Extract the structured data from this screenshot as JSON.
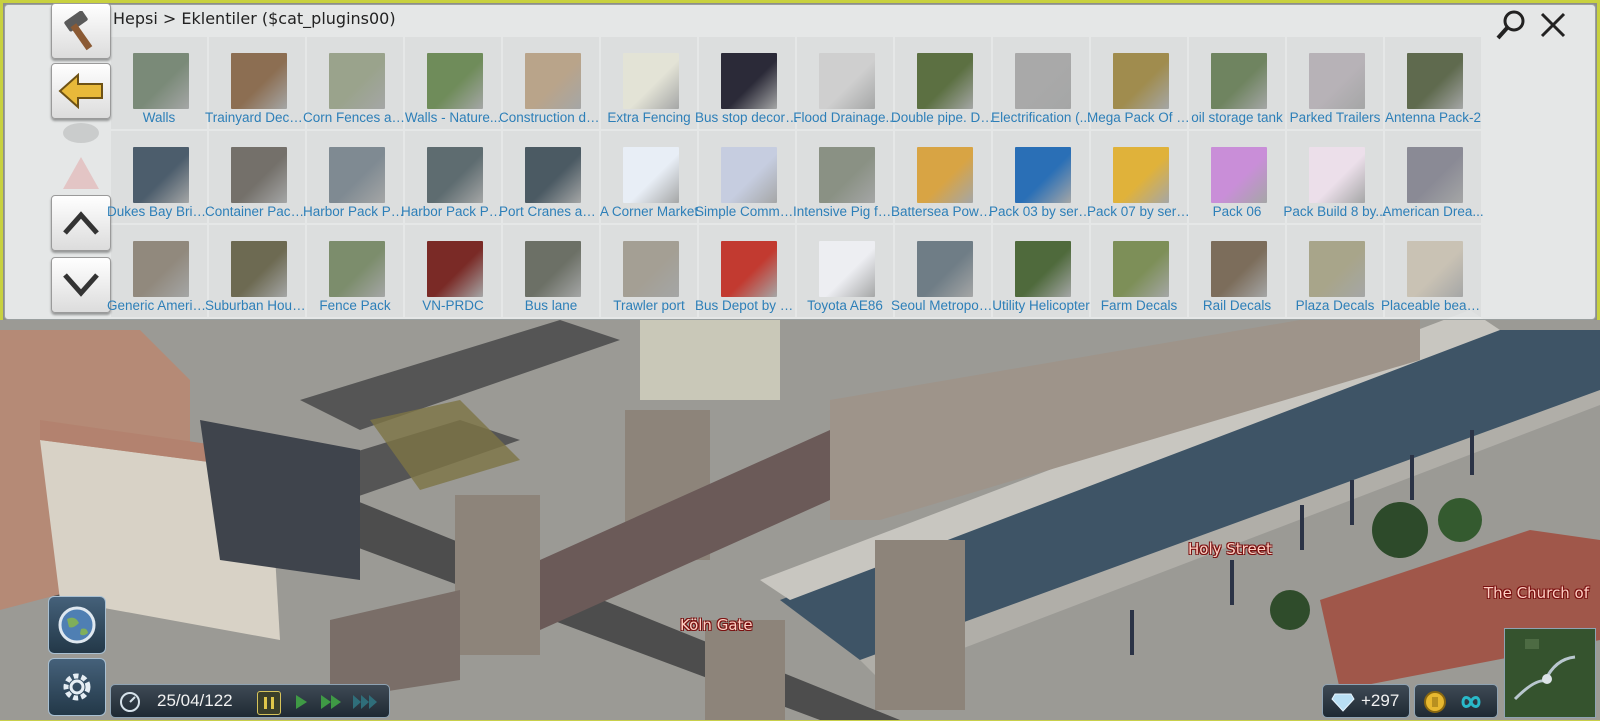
{
  "header": {
    "breadcrumb": "Hepsi > Eklentiler ($cat_plugins00)"
  },
  "icons": {
    "hammer": "hammer-icon",
    "back": "arrow-left-icon",
    "up": "chevron-up-icon",
    "down": "chevron-down-icon",
    "search": "search-icon",
    "close": "close-icon",
    "world": "globe-icon",
    "settings": "gear-icon",
    "speed": "speedometer-icon",
    "diamond": "diamond-icon",
    "coin": "coin-icon",
    "infinity": "infinity-icon"
  },
  "plugins": [
    {
      "label": "Walls",
      "color": "#7a8a78"
    },
    {
      "label": "Trainyard Decor...",
      "color": "#8c6e52"
    },
    {
      "label": "Corn Fences an...",
      "color": "#9aa38c"
    },
    {
      "label": "Walls - Nature...",
      "color": "#6f8c5a"
    },
    {
      "label": "Construction de...",
      "color": "#b9a48a"
    },
    {
      "label": "Extra Fencing",
      "color": "#e3e3d6"
    },
    {
      "label": "Bus stop decora...",
      "color": "#2b2a38"
    },
    {
      "label": "Flood Drainage...",
      "color": "#cfcfcf"
    },
    {
      "label": "Double pipe. De...",
      "color": "#5c7042"
    },
    {
      "label": "Electrification (...",
      "color": "#a9a9a9"
    },
    {
      "label": "Mega Pack Of M...",
      "color": "#a08c4e"
    },
    {
      "label": "oil storage tank",
      "color": "#6f8460"
    },
    {
      "label": "Parked Trailers",
      "color": "#b7b2b7"
    },
    {
      "label": "Antenna Pack-2",
      "color": "#5f6a4e"
    },
    {
      "label": "Dukes Bay Bridge",
      "color": "#4c5d6c"
    },
    {
      "label": "Container Pack A",
      "color": "#74706a"
    },
    {
      "label": "Harbor Pack Par...",
      "color": "#7f8a92"
    },
    {
      "label": "Harbor Pack Par...",
      "color": "#5e6c70"
    },
    {
      "label": "Port Cranes and...",
      "color": "#4b5a63"
    },
    {
      "label": "A Corner Market",
      "color": "#e8eef6"
    },
    {
      "label": "Simple Commer...",
      "color": "#c6cde0"
    },
    {
      "label": "Intensive Pig farm",
      "color": "#8a9184"
    },
    {
      "label": "Battersea Powe...",
      "color": "#d8a444"
    },
    {
      "label": "Pack 03 by sergi...",
      "color": "#2a6fb6"
    },
    {
      "label": "Pack 07 by sergi...",
      "color": "#e0b23a"
    },
    {
      "label": "Pack 06",
      "color": "#c98ed8"
    },
    {
      "label": "Pack Build 8 by...",
      "color": "#ecdfea"
    },
    {
      "label": "American Drea...",
      "color": "#8a8a95"
    },
    {
      "label": "Generic America...",
      "color": "#91897d"
    },
    {
      "label": "Suburban House...",
      "color": "#6d6a52"
    },
    {
      "label": "Fence Pack",
      "color": "#7c8d6c"
    },
    {
      "label": "VN-PRDC",
      "color": "#7a2a26"
    },
    {
      "label": "Bus lane",
      "color": "#6c7066"
    },
    {
      "label": "Trawler port",
      "color": "#a49f94"
    },
    {
      "label": "Bus Depot by se...",
      "color": "#c23a30"
    },
    {
      "label": "Toyota AE86",
      "color": "#edeef2"
    },
    {
      "label": "Seoul Metropoli...",
      "color": "#6f7d86"
    },
    {
      "label": "Utility Helicopter",
      "color": "#4f6a3c"
    },
    {
      "label": "Farm Decals",
      "color": "#7d8f58"
    },
    {
      "label": "Rail Decals",
      "color": "#7c6d5b"
    },
    {
      "label": "Plaza Decals",
      "color": "#a8a58a"
    },
    {
      "label": "Placeable beach...",
      "color": "#c9c2b4"
    }
  ],
  "status": {
    "date": "25/04/122",
    "diamonds": "+297"
  },
  "map_labels": {
    "holy_street": "Holy Street",
    "koln_gate": "Köln Gate",
    "church": "The Church of"
  }
}
